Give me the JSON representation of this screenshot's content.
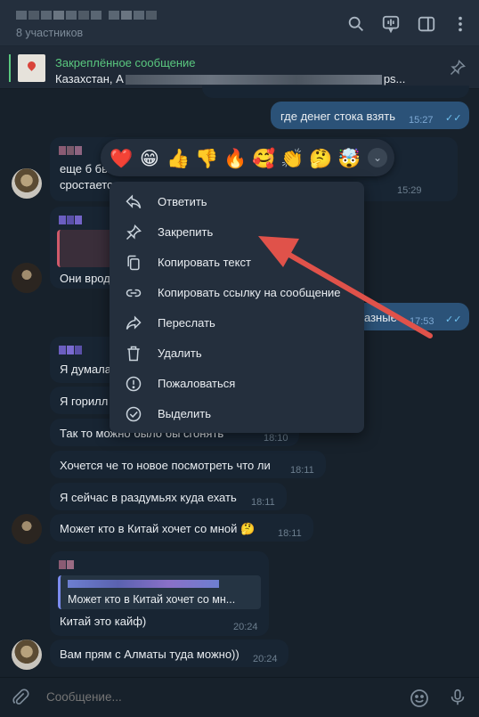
{
  "header": {
    "subtitle": "8 участников",
    "icons": [
      "search-icon",
      "voice-chat-icon",
      "sidebar-toggle-icon",
      "more-icon"
    ]
  },
  "pinned": {
    "title": "Закреплённое сообщение",
    "text_start": "Казахстан, А",
    "text_end": "ps..."
  },
  "messages": [
    {
      "text": "где денег стока взять",
      "time": "15:27"
    },
    {
      "text_line1": "еще б бы",
      "text_line2": "сростается",
      "time": "15:29"
    },
    {
      "text": "Они врод",
      "time": ""
    },
    {
      "text": "азные",
      "time": "17:53"
    },
    {
      "text": "Я думала",
      "time": ""
    },
    {
      "text": "Я горилл",
      "time": ""
    },
    {
      "text": "Так то можно было бы сгонять",
      "time": "18:10"
    },
    {
      "text": "Хочется че то новое посмотреть что ли",
      "time": "18:11"
    },
    {
      "text": "Я сейчас в раздумьях куда ехать",
      "time": "18:11"
    },
    {
      "text": "Может кто в Китай хочет со мной 🤔",
      "time": "18:11"
    },
    {
      "quote": "Может кто в Китай хочет со мн...",
      "text": "Китай это кайф)",
      "time": "20:24"
    },
    {
      "text": "Вам прям с Алматы туда можно))",
      "time": "20:24"
    }
  ],
  "reactions": [
    "❤️",
    "😁",
    "👍",
    "👎",
    "🔥",
    "🥰",
    "👏",
    "🤔",
    "🤯"
  ],
  "menu": {
    "items": [
      {
        "label": "Ответить",
        "icon": "reply-icon"
      },
      {
        "label": "Закрепить",
        "icon": "pin-icon"
      },
      {
        "label": "Копировать текст",
        "icon": "copy-icon"
      },
      {
        "label": "Копировать ссылку на сообщение",
        "icon": "link-icon"
      },
      {
        "label": "Переслать",
        "icon": "forward-icon"
      },
      {
        "label": "Удалить",
        "icon": "trash-icon"
      },
      {
        "label": "Пожаловаться",
        "icon": "report-icon"
      },
      {
        "label": "Выделить",
        "icon": "select-icon"
      }
    ]
  },
  "input": {
    "placeholder": "Сообщение..."
  },
  "colors": {
    "accent_green": "#5ac87f",
    "annotation_arrow": "#e0524a",
    "outgoing_bubble": "#2b5278",
    "incoming_bubble": "#182533"
  }
}
